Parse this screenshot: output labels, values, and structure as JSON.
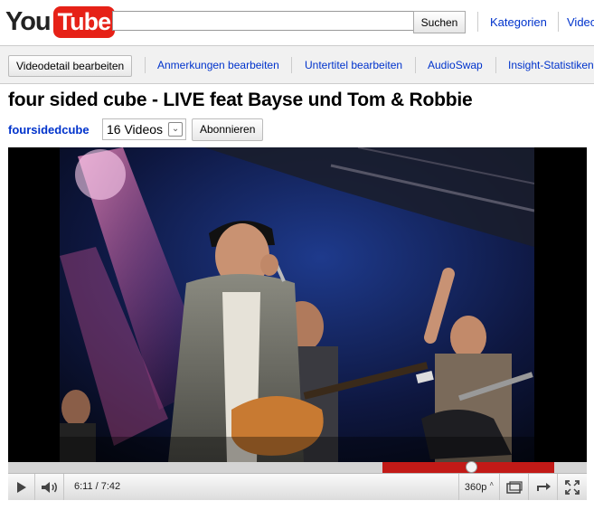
{
  "header": {
    "logo_text_left": "You",
    "logo_text_right": "Tube",
    "search_value": "",
    "search_button": "Suchen",
    "nav": [
      "Kategorien",
      "Videos"
    ]
  },
  "toolbar": {
    "edit_button": "Videodetail bearbeiten",
    "links": [
      "Anmerkungen bearbeiten",
      "Untertitel bearbeiten",
      "AudioSwap",
      "Insight-Statistiken"
    ]
  },
  "video": {
    "title": "four sided cube - LIVE feat Bayse und Tom & Robbie",
    "channel": "foursidedcube",
    "videos_count": "16 Videos",
    "subscribe_button": "Abonnieren"
  },
  "player": {
    "time": "6:11 / 7:42",
    "quality": "360p",
    "progress_fraction": 0.8,
    "buffered_start_fraction": 0.647,
    "buffered_end_fraction": 0.944,
    "icons": [
      "play-icon",
      "volume-icon",
      "popout-icon",
      "expand-icon",
      "fullscreen-icon"
    ]
  },
  "colors": {
    "brand_red": "#e62117",
    "link_blue": "#0033cc",
    "progress_red": "#c21a17"
  }
}
